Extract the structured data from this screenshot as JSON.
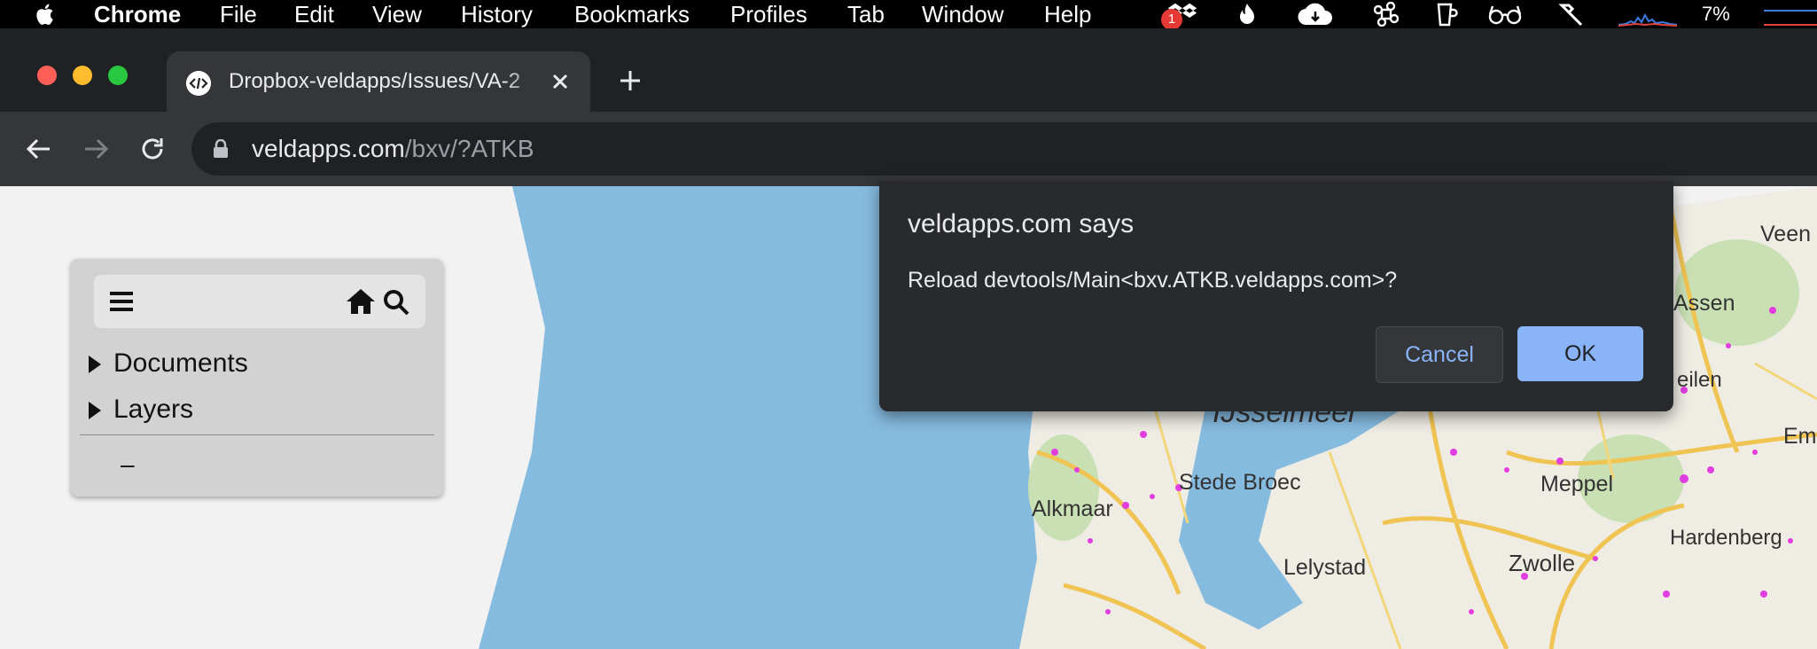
{
  "menubar": {
    "app_name": "Chrome",
    "items": [
      "File",
      "Edit",
      "View",
      "History",
      "Bookmarks",
      "Profiles",
      "Tab",
      "Window",
      "Help"
    ],
    "notification_badge": "1",
    "battery_percent": "7%"
  },
  "tabs": [
    {
      "title": "Dropbox-veldapps/Issues/VA-2",
      "active": true
    }
  ],
  "toolbar": {
    "url_host": "veldapps.com",
    "url_path": "/bxv/?ATKB"
  },
  "panel": {
    "tree_items": [
      "Documents",
      "Layers"
    ],
    "footer": "–"
  },
  "map": {
    "labels": [
      "IJsselmeer",
      "Stede Broec",
      "Alkmaar",
      "Lelystad",
      "Zwolle",
      "Meppel",
      "Hardenberg",
      "Assen",
      "Veen",
      "eilen",
      "Em"
    ]
  },
  "dialog": {
    "heading": "veldapps.com says",
    "message": "Reload devtools/Main<bxv.ATKB.veldapps.com>?",
    "cancel_label": "Cancel",
    "ok_label": "OK"
  },
  "colors": {
    "water": "#86bbe0",
    "land": "#f2f2f2",
    "dialog_bg": "#292a2d",
    "accent": "#8ab4f8"
  }
}
